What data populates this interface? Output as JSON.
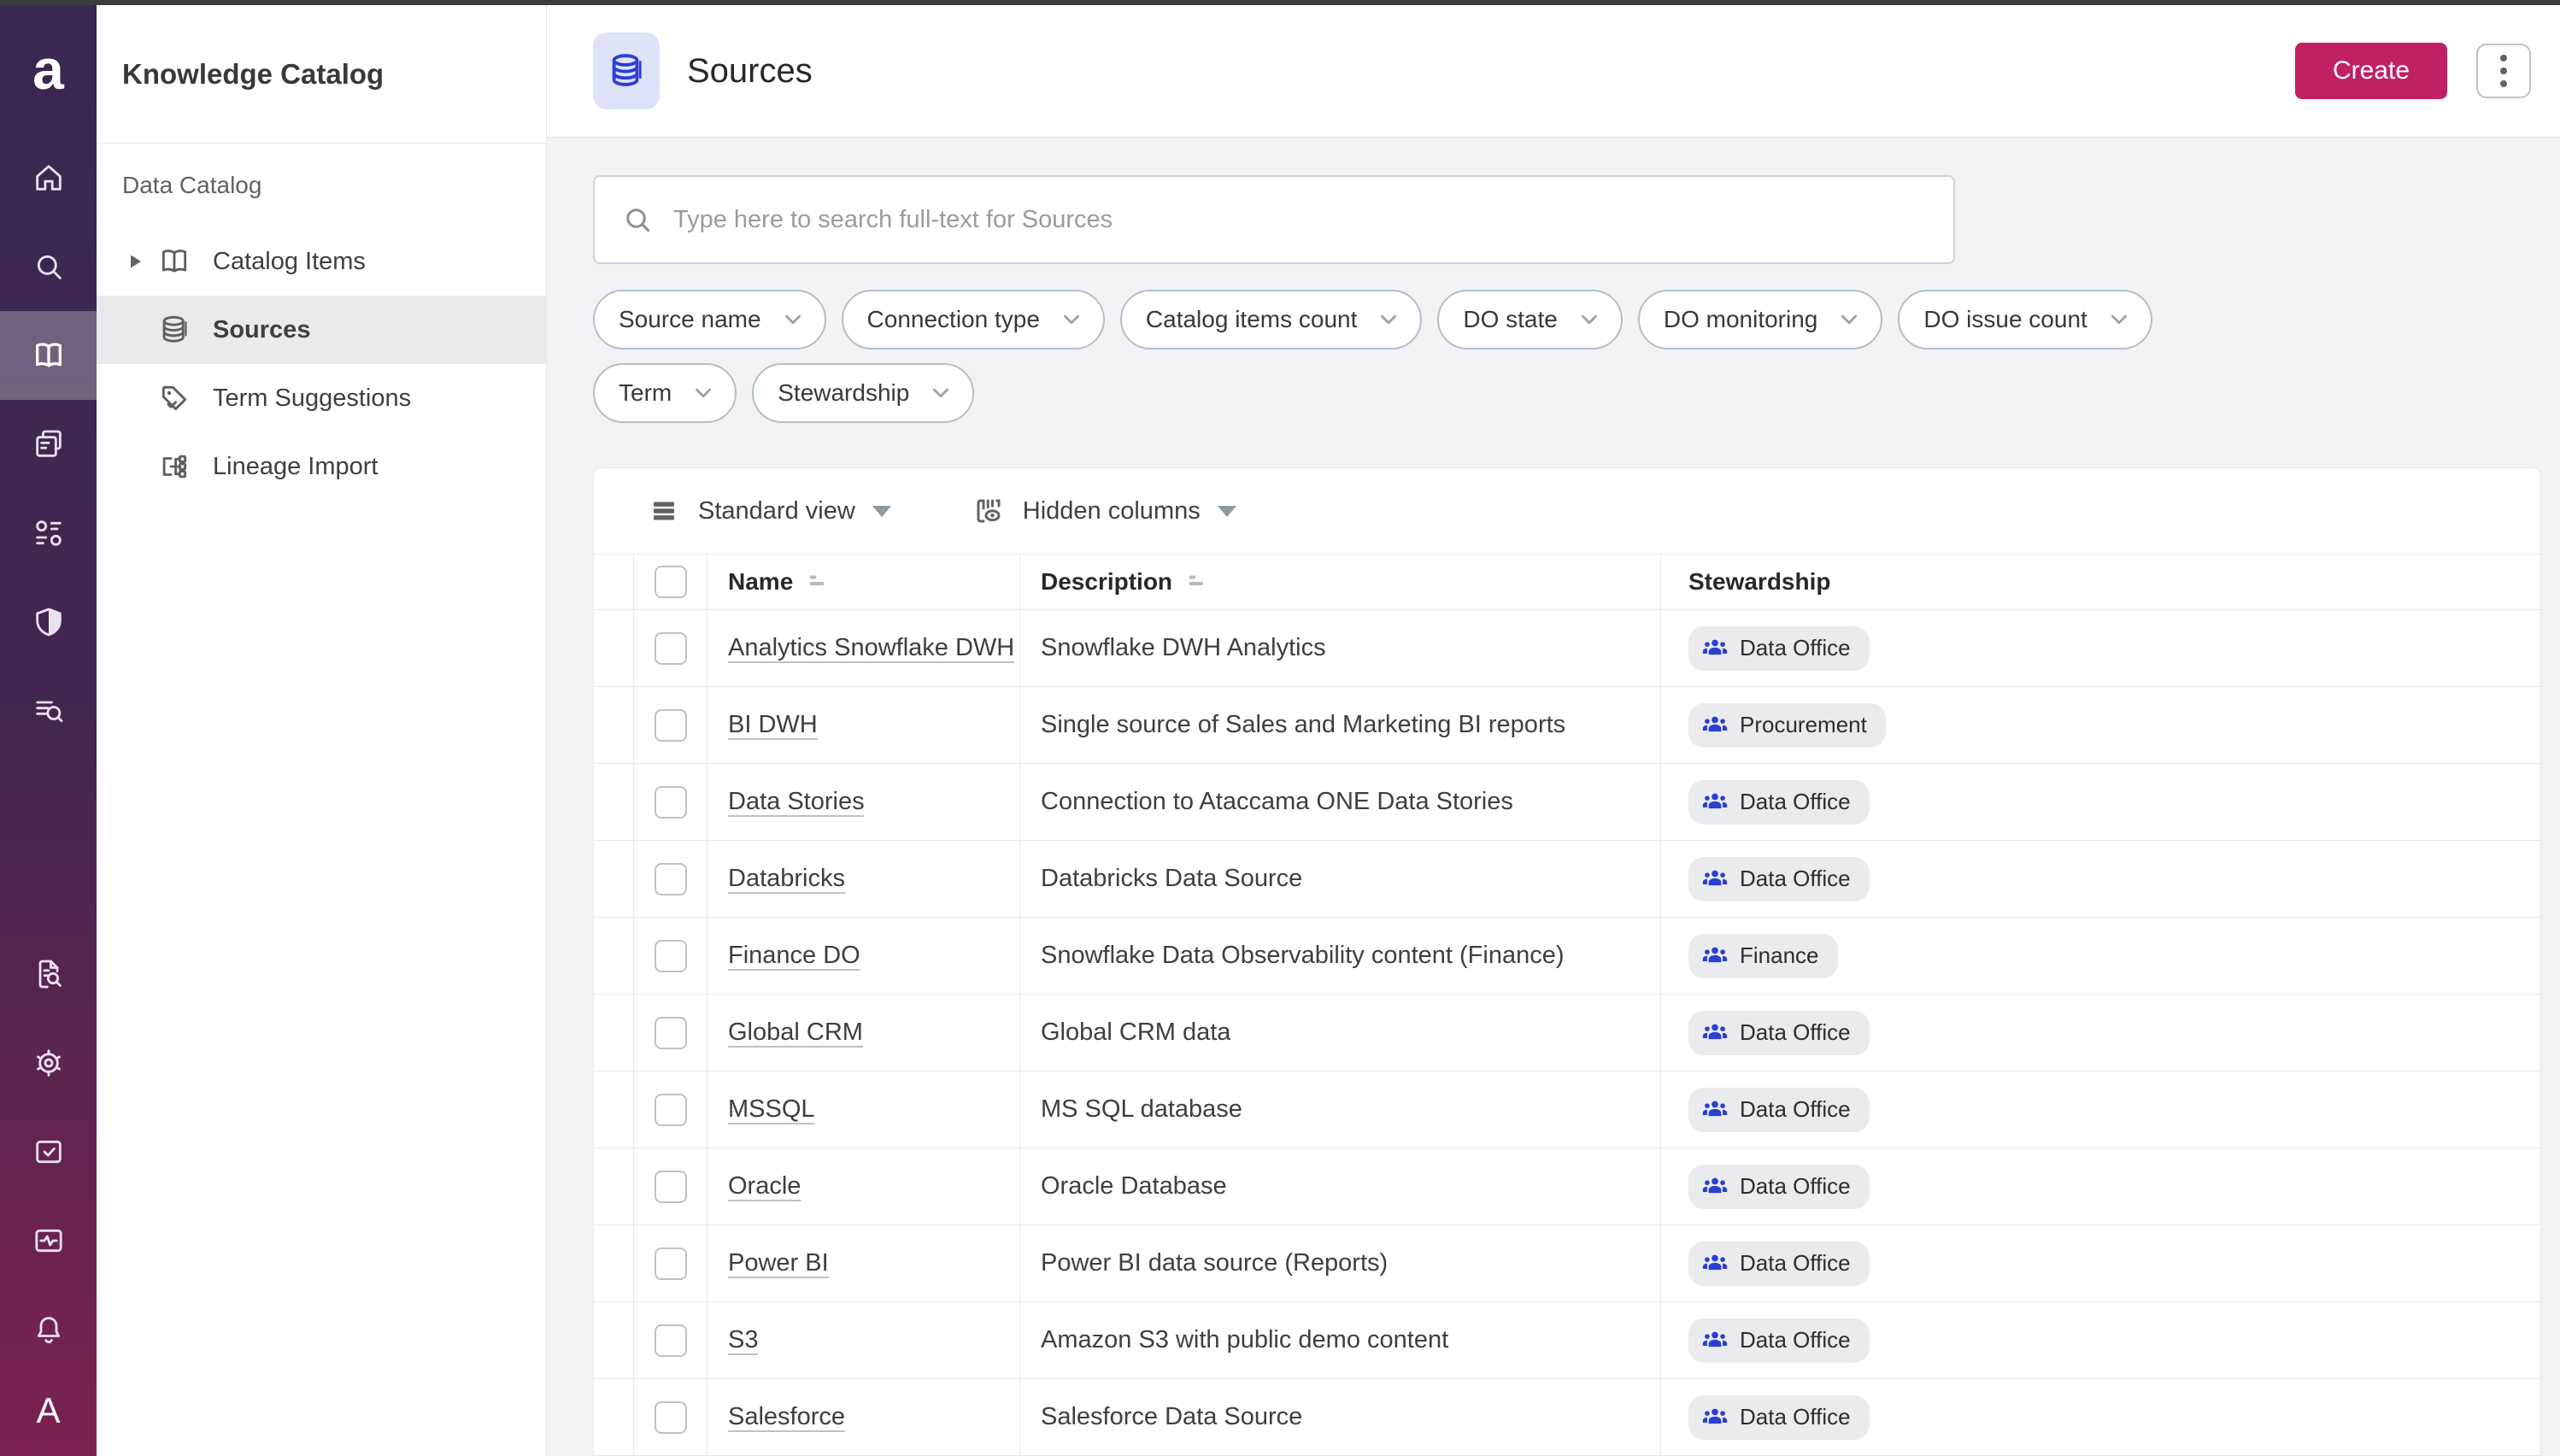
{
  "rail": {
    "logo": "a",
    "avatar": "A",
    "items": [
      "home-icon",
      "search-icon",
      "knowledge-catalog-book-icon",
      "documents-icon",
      "components-icon",
      "shield-icon",
      "list-search-icon"
    ],
    "bottom_items": [
      "document-search-icon",
      "gear-icon",
      "tasks-icon",
      "monitoring-icon",
      "bell-icon"
    ]
  },
  "sidebar": {
    "title": "Knowledge Catalog",
    "section_label": "Data Catalog",
    "items": [
      {
        "label": "Catalog Items",
        "icon": "book-icon",
        "expandable": true,
        "active": false
      },
      {
        "label": "Sources",
        "icon": "database-icon",
        "expandable": false,
        "active": true
      },
      {
        "label": "Term Suggestions",
        "icon": "tag-icon",
        "expandable": false,
        "active": false
      },
      {
        "label": "Lineage Import",
        "icon": "lineage-icon",
        "expandable": false,
        "active": false
      }
    ]
  },
  "header": {
    "title": "Sources",
    "title_icon": "database-icon",
    "create_label": "Create",
    "more_actions_icon": "kebab-menu-icon"
  },
  "search": {
    "placeholder": "Type here to search full-text for Sources"
  },
  "filters": {
    "row1": [
      {
        "label": "Source name"
      },
      {
        "label": "Connection type"
      },
      {
        "label": "Catalog items count"
      },
      {
        "label": "DO state"
      },
      {
        "label": "DO monitoring"
      },
      {
        "label": "DO issue count"
      }
    ],
    "row2": [
      {
        "label": "Term"
      },
      {
        "label": "Stewardship"
      }
    ]
  },
  "toolbar": {
    "view_label": "Standard view",
    "hidden_columns_label": "Hidden columns"
  },
  "table": {
    "columns": [
      "Name",
      "Description",
      "Stewardship"
    ],
    "rows": [
      {
        "name": "Analytics Snowflake DWH",
        "description": "Snowflake DWH Analytics",
        "steward": "Data Office"
      },
      {
        "name": "BI DWH",
        "description": "Single source of Sales and Marketing BI reports",
        "steward": "Procurement"
      },
      {
        "name": "Data Stories",
        "description": "Connection to Ataccama ONE Data Stories",
        "steward": "Data Office"
      },
      {
        "name": "Databricks",
        "description": "Databricks Data Source",
        "steward": "Data Office"
      },
      {
        "name": "Finance DO",
        "description": "Snowflake Data Observability content (Finance)",
        "steward": "Finance"
      },
      {
        "name": "Global CRM",
        "description": "Global CRM data",
        "steward": "Data Office"
      },
      {
        "name": "MSSQL",
        "description": "MS SQL database",
        "steward": "Data Office"
      },
      {
        "name": "Oracle",
        "description": "Oracle Database",
        "steward": "Data Office"
      },
      {
        "name": "Power BI",
        "description": "Power BI data source (Reports)",
        "steward": "Data Office"
      },
      {
        "name": "S3",
        "description": "Amazon S3 with public demo content",
        "steward": "Data Office"
      },
      {
        "name": "Salesforce",
        "description": "Salesforce Data Source",
        "steward": "Data Office"
      }
    ]
  },
  "colors": {
    "accent_pink": "#c12063",
    "icon_blue": "#2c3ed3",
    "badge_bg": "#e9ebee",
    "rail_gradient_top": "#392850",
    "rail_gradient_bottom": "#7c2150",
    "content_bg": "#f1f3f6"
  }
}
